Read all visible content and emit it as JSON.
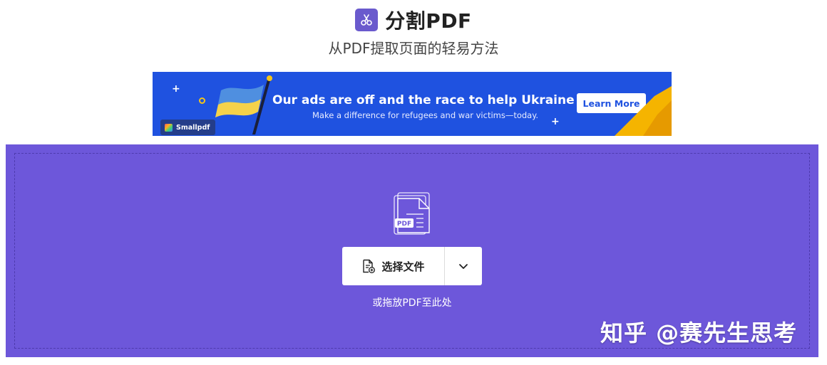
{
  "header": {
    "icon": "scissors-icon",
    "title": "分割PDF",
    "subtitle": "从PDF提取页面的轻易方法"
  },
  "ad": {
    "headline": "Our ads are off and the race to help Ukraine is on",
    "subline": "Make a difference for refugees and war victims—today.",
    "cta_label": "Learn More",
    "brand": "Smallpdf",
    "colors": {
      "background": "#1f52e0",
      "flag_blue": "#4f8fe0",
      "flag_yellow": "#f5d24a",
      "corner": "#f5b400"
    }
  },
  "dropzone": {
    "illustration": "pdf-files-icon",
    "illustration_label": "PDF",
    "choose_file_label": "选择文件",
    "choose_file_icon": "file-add-icon",
    "menu_icon": "chevron-down-icon",
    "hint": "或拖放PDF至此处",
    "background_color": "#6d57da"
  },
  "watermark": {
    "text": "知乎 @赛先生思考"
  }
}
